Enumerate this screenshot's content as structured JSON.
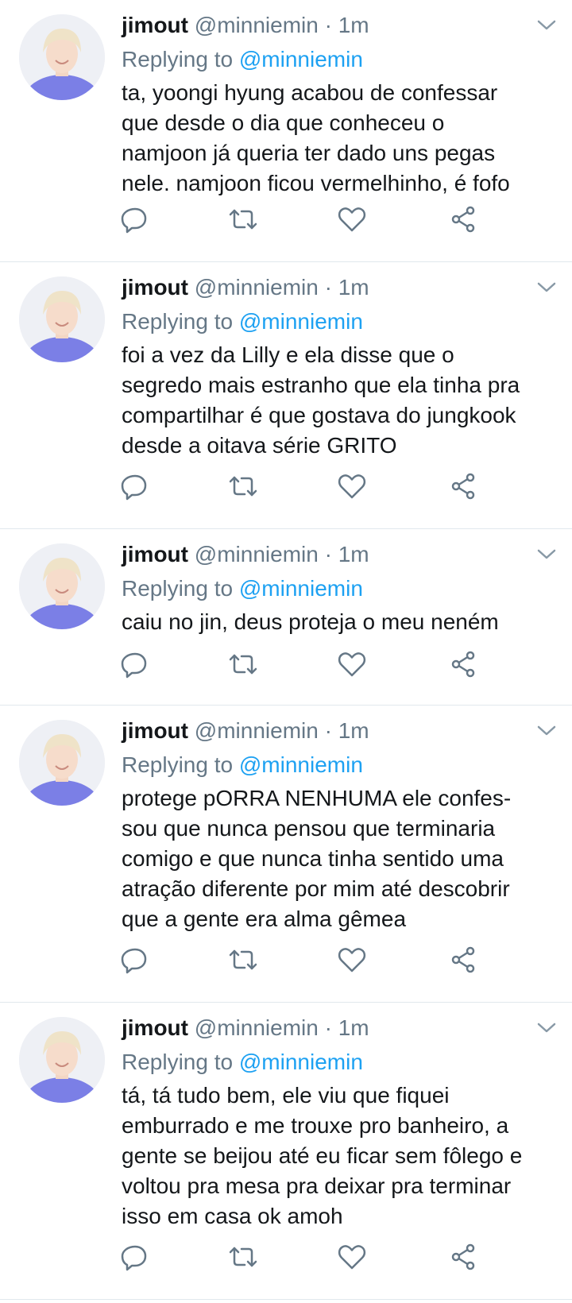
{
  "tweets": [
    {
      "display_name": "jimout",
      "handle": "@minniemin",
      "time": "· 1m",
      "replying_prefix": "Replying to",
      "replying_handle": "@minniemin",
      "text": "ta, yoongi hyung acabou de confessar\nque desde o dia que conheceu o\nnamjoon já queria ter dado uns pegas\nnele. namjoon ficou vermelhinho, é fofo"
    },
    {
      "display_name": "jimout",
      "handle": "@minniemin",
      "time": "· 1m",
      "replying_prefix": "Replying to",
      "replying_handle": "@minniemin",
      "text": "foi a vez da Lilly e ela disse que o\nsegredo mais estranho que ela tinha pra\ncompartilhar é que gostava do jungkook\ndesde a oitava série GRITO"
    },
    {
      "display_name": "jimout",
      "handle": "@minniemin",
      "time": "· 1m",
      "replying_prefix": "Replying to",
      "replying_handle": "@minniemin",
      "text": "caiu no jin, deus proteja o meu neném"
    },
    {
      "display_name": "jimout",
      "handle": "@minniemin",
      "time": "· 1m",
      "replying_prefix": "Replying to",
      "replying_handle": "@minniemin",
      "text": "protege pORRA NENHUMA ele confes-\nsou que nunca pensou que terminaria\ncomigo e que nunca tinha sentido uma\natração diferente por mim até descobrir\nque a gente era alma gêmea"
    },
    {
      "display_name": "jimout",
      "handle": "@minniemin",
      "time": "· 1m",
      "replying_prefix": "Replying to",
      "replying_handle": "@minniemin",
      "text": "tá, tá tudo bem, ele viu que fiquei\nemburrado e me trouxe pro banheiro, a\ngente se beijou até eu ficar sem fôlego e\nvoltou pra mesa pra deixar pra terminar\nisso em casa ok amoh"
    }
  ],
  "icons": {
    "reply": "reply-icon",
    "retweet": "retweet-icon",
    "like": "like-icon",
    "share": "share-icon",
    "more": "chevron-down-icon"
  },
  "colors": {
    "name": "#14171a",
    "meta": "#657786",
    "mention": "#1da1f2",
    "divider": "#e1e8ed",
    "avatar_shirt": "#7b7fe6",
    "avatar_hair": "#efe3c8"
  }
}
